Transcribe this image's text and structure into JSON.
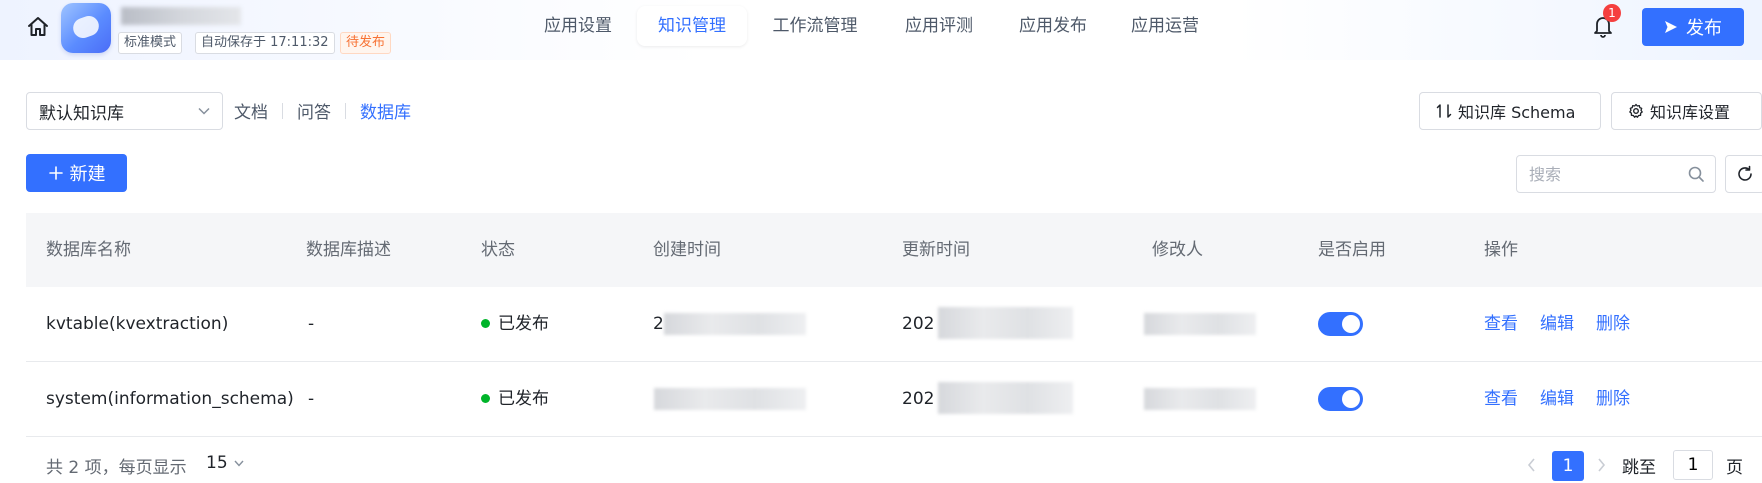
{
  "header": {
    "mode_tag": "标准模式",
    "autosave_tag": "自动保存于 17:11:32",
    "status_tag": "待发布",
    "nav": [
      {
        "label": "应用设置",
        "active": false
      },
      {
        "label": "知识管理",
        "active": true
      },
      {
        "label": "工作流管理",
        "active": false
      },
      {
        "label": "应用评测",
        "active": false
      },
      {
        "label": "应用发布",
        "active": false
      },
      {
        "label": "应用运营",
        "active": false
      }
    ],
    "notification_count": "1",
    "publish_label": "发布"
  },
  "toolbar": {
    "kb_select_value": "默认知识库",
    "kb_tabs": [
      {
        "label": "文档",
        "active": false
      },
      {
        "label": "问答",
        "active": false
      },
      {
        "label": "数据库",
        "active": true
      }
    ],
    "schema_button": "知识库 Schema",
    "settings_button": "知识库设置",
    "new_button": "新建",
    "search_placeholder": "搜索"
  },
  "table": {
    "columns": [
      "数据库名称",
      "数据库描述",
      "状态",
      "创建时间",
      "更新时间",
      "修改人",
      "是否启用",
      "操作"
    ],
    "rows": [
      {
        "name": "kvtable(kvextraction)",
        "description": "-",
        "status": "已发布",
        "created": "2",
        "updated": "202",
        "enabled": true
      },
      {
        "name": "system(information_schema)",
        "description": "-",
        "status": "已发布",
        "created": "",
        "updated": "202",
        "enabled": true
      }
    ],
    "actions": {
      "view": "查看",
      "edit": "编辑",
      "delete": "删除"
    }
  },
  "pagination": {
    "total_text": "共 2 项，每页显示",
    "page_size": "15",
    "current_page": "1",
    "jump_label": "跳至",
    "jump_value": "1",
    "page_suffix": "页"
  },
  "colors": {
    "primary": "#3370ff",
    "published_dot": "#00b42a",
    "pending": "#f77234",
    "badge": "#f53f3f"
  }
}
